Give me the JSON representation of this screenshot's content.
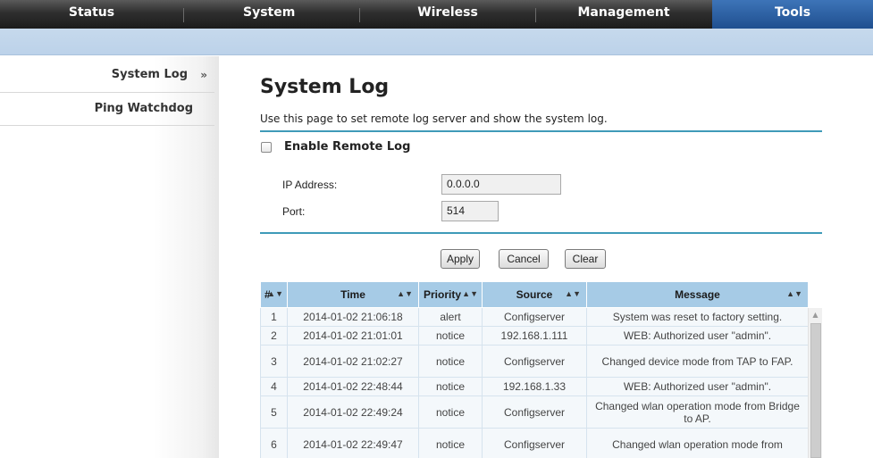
{
  "nav": {
    "items": [
      {
        "label": "Status"
      },
      {
        "label": "System"
      },
      {
        "label": "Wireless"
      },
      {
        "label": "Management"
      },
      {
        "label": "Tools"
      }
    ],
    "active": "Tools"
  },
  "sidebar": {
    "items": [
      {
        "label": "System Log",
        "arrow": "»"
      },
      {
        "label": "Ping Watchdog"
      }
    ]
  },
  "page": {
    "title": "System Log",
    "description": "Use this page to set remote log server and show the system log.",
    "enable_remote_log_label": "Enable Remote Log",
    "enable_remote_log_checked": false,
    "ip_label": "IP Address:",
    "ip_value": "0.0.0.0",
    "port_label": "Port:",
    "port_value": "514",
    "apply_label": "Apply",
    "cancel_label": "Cancel",
    "clear_label": "Clear"
  },
  "log_table": {
    "headers": [
      "#",
      "Time",
      "Priority",
      "Source",
      "Message"
    ],
    "rows": [
      {
        "n": "1",
        "time": "2014-01-02 21:06:18",
        "priority": "alert",
        "source": "Configserver",
        "message": "System was reset to factory setting."
      },
      {
        "n": "2",
        "time": "2014-01-02 21:01:01",
        "priority": "notice",
        "source": "192.168.1.111",
        "message": "WEB: Authorized user \"admin\"."
      },
      {
        "n": "3",
        "time": "2014-01-02 21:02:27",
        "priority": "notice",
        "source": "Configserver",
        "message": "Changed device mode from TAP to FAP."
      },
      {
        "n": "4",
        "time": "2014-01-02 22:48:44",
        "priority": "notice",
        "source": "192.168.1.33",
        "message": "WEB: Authorized user \"admin\"."
      },
      {
        "n": "5",
        "time": "2014-01-02 22:49:24",
        "priority": "notice",
        "source": "Configserver",
        "message": "Changed wlan operation mode from Bridge to AP."
      },
      {
        "n": "6",
        "time": "2014-01-02 22:49:47",
        "priority": "notice",
        "source": "Configserver",
        "message": "Changed wlan operation mode from"
      }
    ]
  },
  "icons": {
    "sort": "sort-arrows-icon",
    "scroll_up": "scroll-up-icon",
    "sidebar_arrow": "double-chevron-right-icon"
  },
  "colors": {
    "nav_active": "#2a5f9e",
    "subbar": "#c2d7ed",
    "rule": "#3f9ab8",
    "table_header": "#a6cbe6"
  }
}
